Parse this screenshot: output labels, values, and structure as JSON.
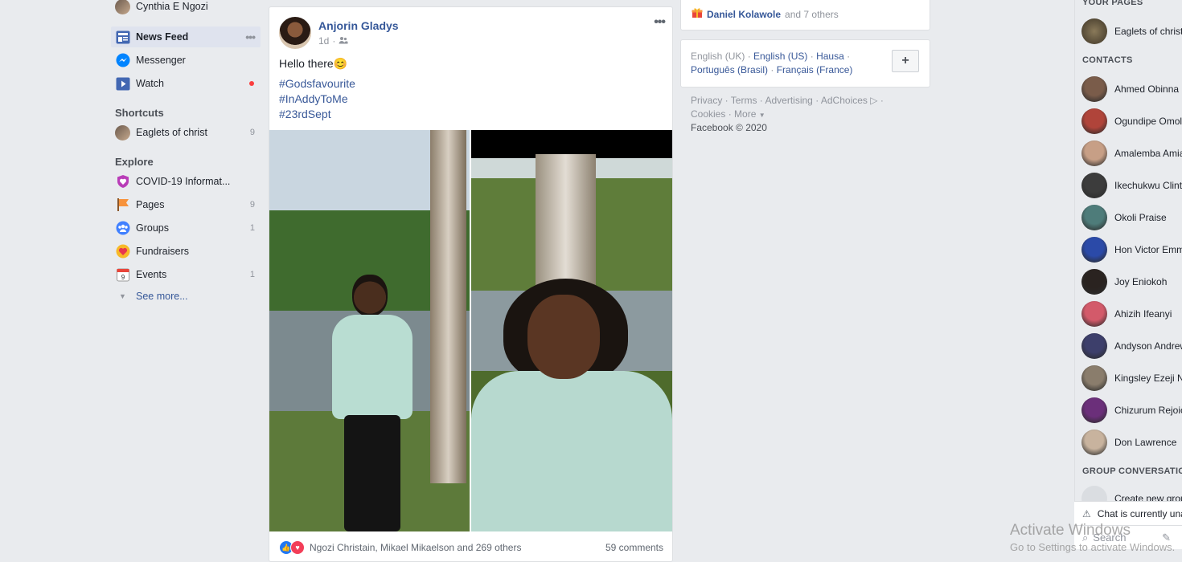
{
  "left_nav": {
    "profile_name": "Cynthia E Ngozi",
    "items": [
      {
        "label": "News Feed",
        "active": true,
        "icon": "news-feed-icon"
      },
      {
        "label": "Messenger",
        "icon": "messenger-icon"
      },
      {
        "label": "Watch",
        "icon": "watch-icon",
        "notification_dot": true
      }
    ],
    "shortcuts_heading": "Shortcuts",
    "shortcuts": [
      {
        "label": "Eaglets of christ",
        "count": "9"
      }
    ],
    "explore_heading": "Explore",
    "explore": [
      {
        "label": "COVID-19 Informat...",
        "count": "",
        "icon": "covid-heart-icon"
      },
      {
        "label": "Pages",
        "count": "9",
        "icon": "pages-flag-icon"
      },
      {
        "label": "Groups",
        "count": "1",
        "icon": "groups-icon"
      },
      {
        "label": "Fundraisers",
        "count": "",
        "icon": "fundraisers-icon"
      },
      {
        "label": "Events",
        "count": "1",
        "icon": "events-calendar-icon"
      }
    ],
    "see_more": "See more..."
  },
  "post": {
    "author": "Anjorin Gladys",
    "time": "1d",
    "text": "Hello there😊",
    "hashtags": [
      "#Godsfavourite",
      "#InAddyToMe",
      "#23rdSept"
    ],
    "reactions_text": "Ngozi Christain, Mikael Mikaelson and 269 others",
    "comments_text": "59 comments"
  },
  "birthday": {
    "name": "Daniel Kolawole",
    "suffix": "and 7 others"
  },
  "languages": {
    "current": "English (UK)",
    "options": [
      "English (US)",
      "Hausa",
      "Português (Brasil)",
      "Français (France)"
    ],
    "add_label": "+"
  },
  "footer": {
    "links": [
      "Privacy",
      "Terms",
      "Advertising",
      "AdChoices",
      "Cookies",
      "More"
    ],
    "copyright": "Facebook © 2020"
  },
  "right_sidebar": {
    "pages_heading": "YOUR PAGES",
    "pages": [
      {
        "name": "Eaglets of christ"
      }
    ],
    "contacts_heading": "CONTACTS",
    "contacts": [
      {
        "name": "Ahmed Obinna",
        "color": "#7a5c4a"
      },
      {
        "name": "Ogundipe Omolola",
        "color": "#b0443a"
      },
      {
        "name": "Amalemba Amiaye",
        "color": "#c79f86"
      },
      {
        "name": "Ikechukwu Clinton",
        "color": "#3c3c3c"
      },
      {
        "name": "Okoli Praise",
        "color": "#4e7c7a"
      },
      {
        "name": "Hon Victor Emmanuel",
        "color": "#2b4aa8"
      },
      {
        "name": "Joy Eniokoh",
        "color": "#2a2320"
      },
      {
        "name": "Ahizih Ifeanyi",
        "color": "#d35a6a"
      },
      {
        "name": "Andyson Andrew",
        "color": "#3d3f6b"
      },
      {
        "name": "Kingsley Ezeji Nnamdi",
        "color": "#8a7d6c"
      },
      {
        "name": "Chizurum Rejoice",
        "color": "#6b2f7a"
      },
      {
        "name": "Don Lawrence",
        "color": "#c8b39e"
      }
    ],
    "group_heading": "GROUP CONVERSATIONS",
    "create_group": "Create new group",
    "chat_off": "Chat is currently unavailable",
    "search_placeholder": "Search"
  },
  "watermark": {
    "line1": "Activate Windows",
    "line2": "Go to Settings to activate Windows."
  }
}
